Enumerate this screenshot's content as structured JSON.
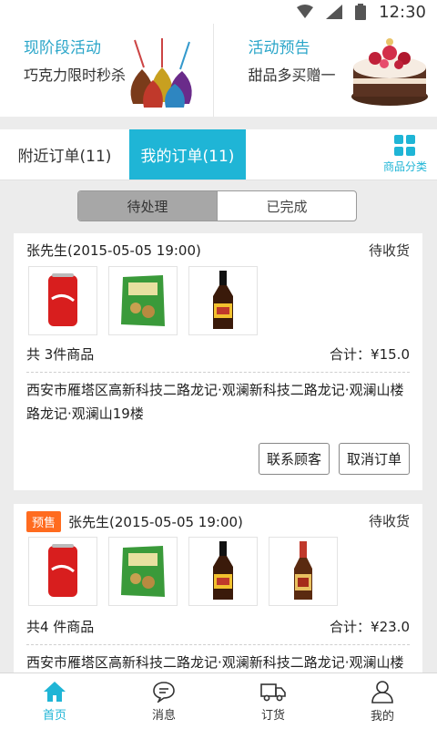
{
  "status_bar": {
    "time": "12:30",
    "icons": [
      "wifi-icon",
      "signal-icon",
      "battery-icon"
    ]
  },
  "promos": [
    {
      "title": "现阶段活动",
      "subtitle": "巧克力限时秒杀",
      "image": "chocolate-image"
    },
    {
      "title": "活动预告",
      "subtitle": "甜品多买赠一",
      "image": "cake-image"
    }
  ],
  "tabs": {
    "nearby": "附近订单(11)",
    "mine": "我的订单(11)",
    "category": "商品分类"
  },
  "segment": {
    "pending": "待处理",
    "done": "已完成"
  },
  "orders": [
    {
      "customer": "张先生(2015-05-05 19:00)",
      "status": "待收货",
      "items": [
        "coca-cola-can",
        "snack-bag",
        "soy-sauce-bottle"
      ],
      "count_text": "共 3件商品",
      "total_text": "合计：¥15.0",
      "address": "西安市雁塔区高新科技二路龙记·观澜新科技二路龙记·观澜山楼路龙记·观澜山19楼",
      "actions": {
        "contact": "联系顾客",
        "cancel": "取消订单"
      }
    },
    {
      "badge": "预售",
      "customer": "张先生(2015-05-05 19:00)",
      "status": "待收货",
      "items": [
        "coca-cola-can",
        "snack-bag",
        "soy-sauce-bottle",
        "vinegar-bottle"
      ],
      "count_text": "共4 件商品",
      "total_text": "合计：¥23.0",
      "address": "西安市雁塔区高新科技二路龙记·观澜新科技二路龙记·观澜山楼"
    }
  ],
  "bottom_nav": [
    {
      "label": "首页",
      "icon": "home-icon",
      "active": true
    },
    {
      "label": "消息",
      "icon": "message-icon",
      "active": false
    },
    {
      "label": "订货",
      "icon": "truck-icon",
      "active": false
    },
    {
      "label": "我的",
      "icon": "user-icon",
      "active": false
    }
  ],
  "colors": {
    "accent": "#1fb5d6",
    "presale": "#ff6b1f"
  }
}
